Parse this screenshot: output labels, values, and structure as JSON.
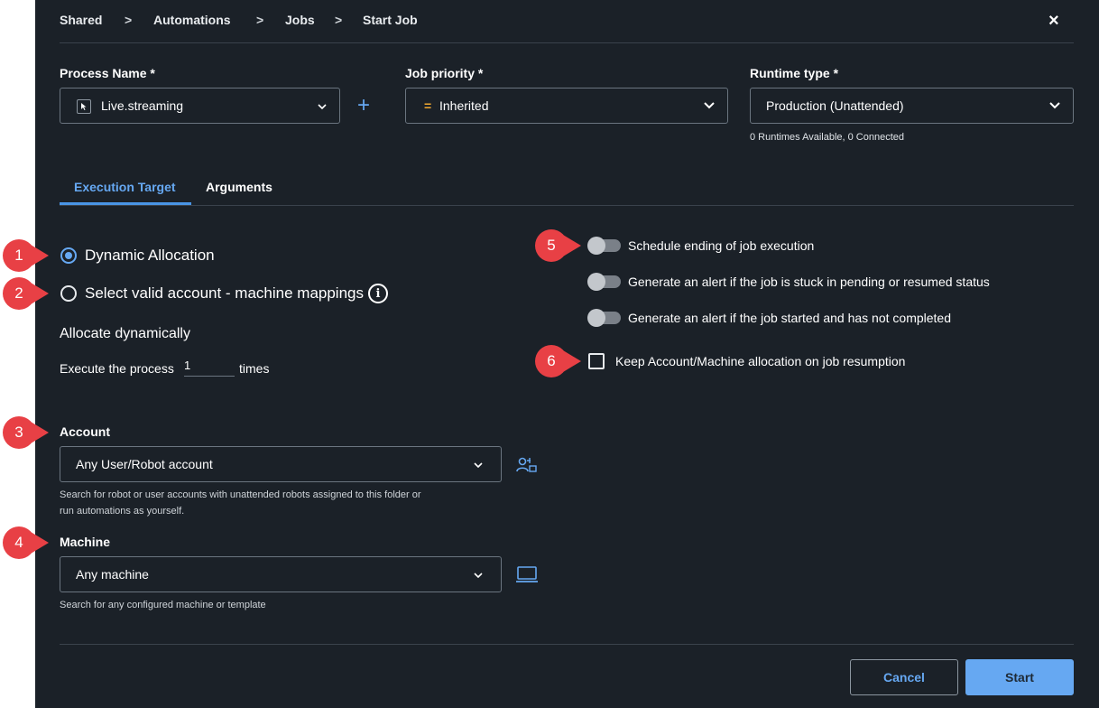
{
  "breadcrumb": {
    "items": [
      "Shared",
      "Automations",
      "Jobs",
      "Start Job"
    ],
    "separator": ">"
  },
  "close_label": "×",
  "process": {
    "label": "Process Name *",
    "value": "Live.streaming",
    "add_label": "+"
  },
  "priority": {
    "label": "Job priority *",
    "icon_text": "=",
    "value": "Inherited"
  },
  "runtime": {
    "label": "Runtime type *",
    "value": "Production (Unattended)",
    "hint": "0 Runtimes Available, 0 Connected"
  },
  "tabs": [
    {
      "label": "Execution Target",
      "active": true
    },
    {
      "label": "Arguments",
      "active": false
    }
  ],
  "allocation": {
    "option_dynamic": "Dynamic Allocation",
    "option_mappings": "Select valid account - machine mappings",
    "info_glyph": "i",
    "selected": "Dynamic Allocation",
    "heading": "Allocate dynamically",
    "execute_prefix": "Execute the process",
    "execute_value": "1",
    "execute_suffix": "times"
  },
  "account": {
    "label": "Account",
    "value": "Any User/Robot account",
    "hint_line1": "Search for robot or user accounts with unattended robots assigned to this folder or",
    "hint_line2": "run automations as yourself."
  },
  "machine": {
    "label": "Machine",
    "value": "Any machine",
    "hint": "Search for any configured machine or template"
  },
  "options": {
    "schedule_ending": {
      "label": "Schedule ending of job execution",
      "enabled": false
    },
    "alert_pending": {
      "label": "Generate an alert if the job is stuck in pending or resumed status",
      "enabled": false
    },
    "alert_not_completed": {
      "label": "Generate an alert if the job started and has not completed",
      "enabled": false
    },
    "keep_allocation": {
      "label": "Keep Account/Machine allocation on job resumption",
      "checked": false
    }
  },
  "markers": [
    "1",
    "2",
    "3",
    "4",
    "5",
    "6"
  ],
  "footer": {
    "cancel_label": "Cancel",
    "start_label": "Start"
  },
  "colors": {
    "panel_bg": "#1b2128",
    "accent": "#66a8f2",
    "marker": "#e84045",
    "priority_icon": "#f0a830"
  },
  "icons": {
    "process_type": "cursor-icon",
    "chevron": "chevron-down-icon",
    "info": "info-icon",
    "account_picker": "user-assign-icon",
    "machine_picker": "laptop-icon",
    "close": "close-icon"
  }
}
